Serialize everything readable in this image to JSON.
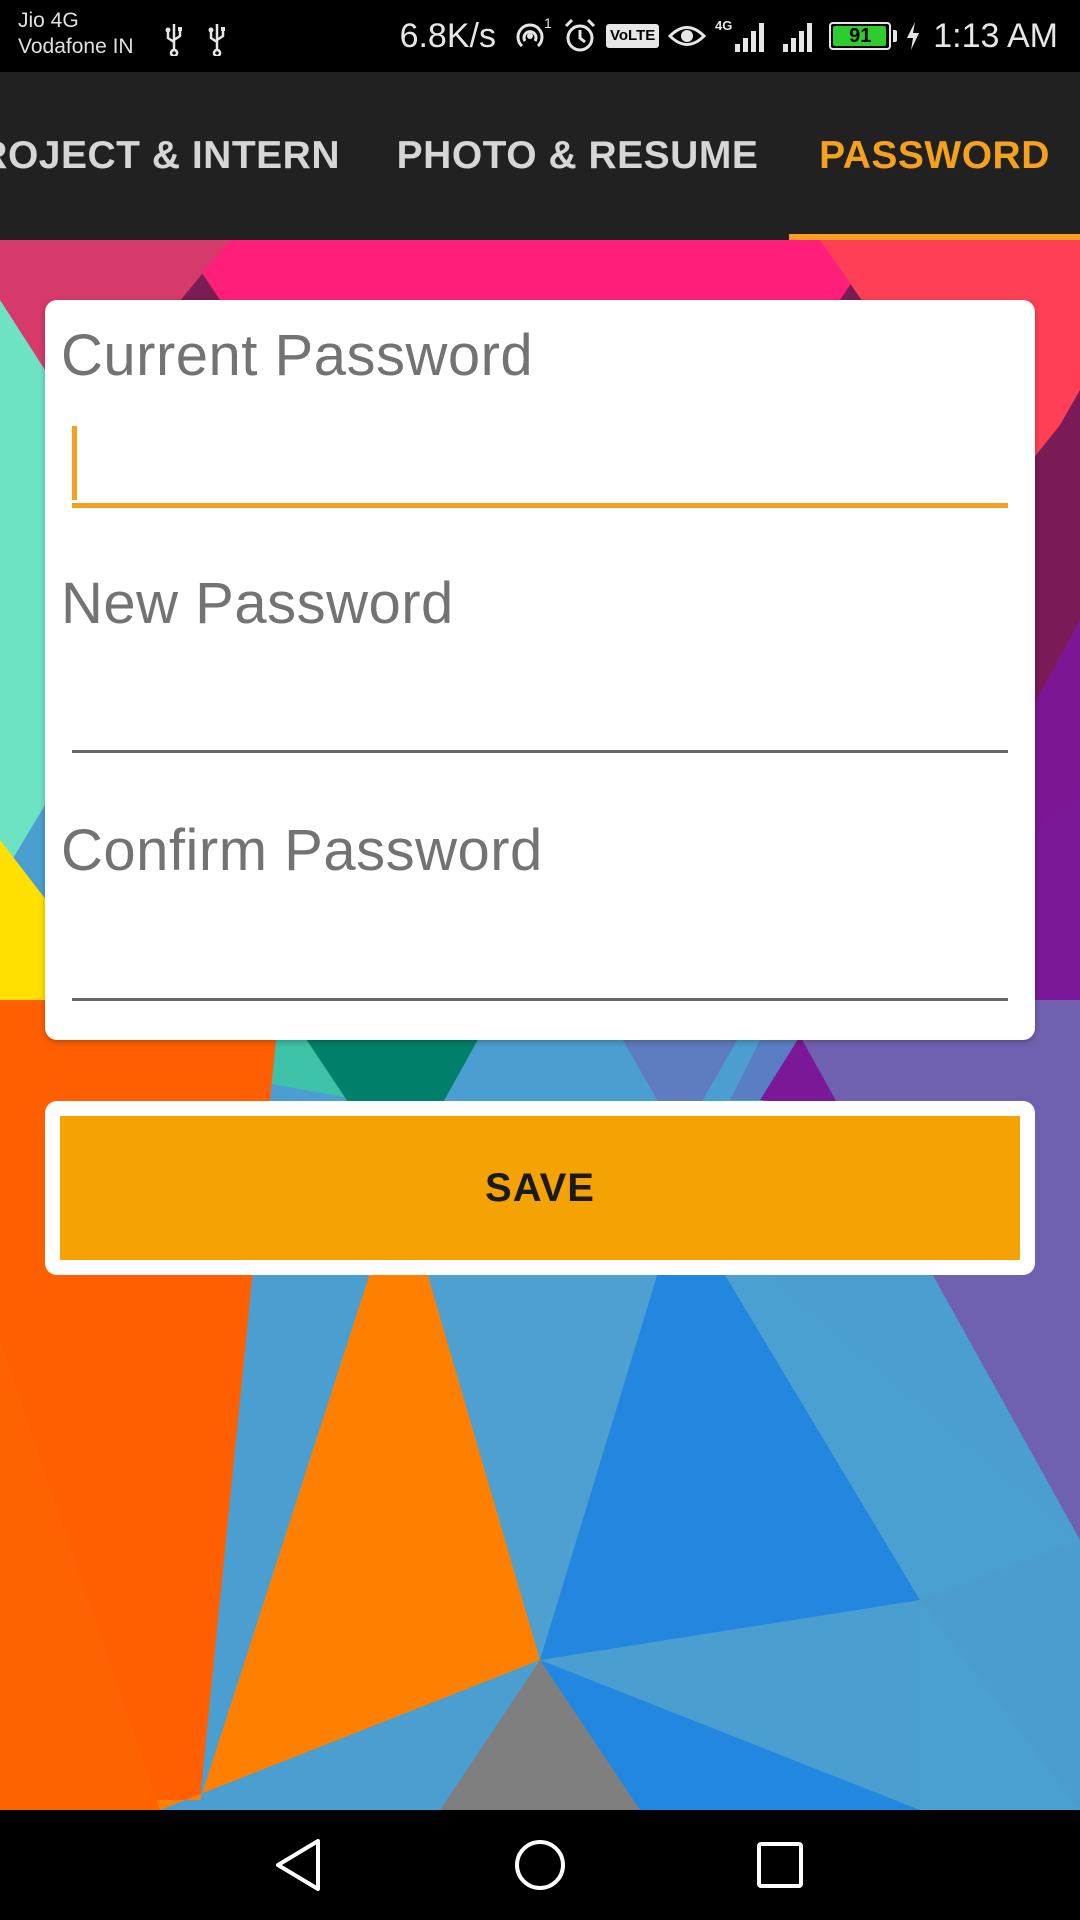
{
  "status_bar": {
    "carrier_1": "Jio 4G",
    "carrier_2": "Vodafone IN",
    "net_speed": "6.8K/s",
    "hotspot_count": "1",
    "volte_label": "VoLTE",
    "network_type": "4G",
    "battery_level": "91",
    "time": "1:13 AM",
    "icons": [
      "usb-icon",
      "usb-icon",
      "hotspot-icon",
      "alarm-icon",
      "volte-icon",
      "eye-icon",
      "signal-icon",
      "signal-icon",
      "battery-icon",
      "charging-icon"
    ]
  },
  "tabs": [
    {
      "label": "ROJECT & INTERN",
      "selected": false
    },
    {
      "label": "PHOTO & RESUME",
      "selected": false
    },
    {
      "label": "PASSWORD",
      "selected": true
    }
  ],
  "form": {
    "current_password": {
      "label": "Current Password",
      "value": ""
    },
    "new_password": {
      "label": "New Password",
      "value": ""
    },
    "confirm_password": {
      "label": "Confirm Password",
      "value": ""
    }
  },
  "save_button": {
    "label": "SAVE"
  },
  "nav_bar": {
    "icons": [
      "back-icon",
      "home-icon",
      "recents-icon"
    ]
  },
  "colors": {
    "accent": "#f5a11f",
    "button": "#f4a204",
    "tab_bar": "#212121"
  }
}
